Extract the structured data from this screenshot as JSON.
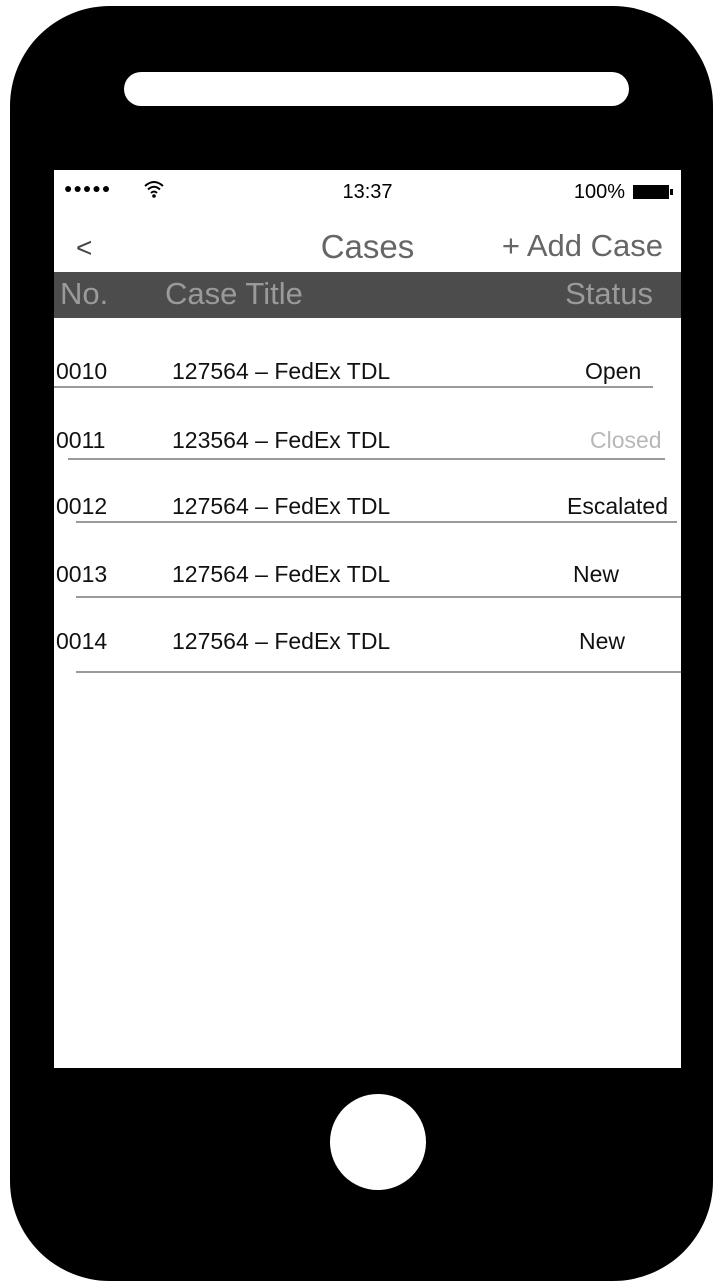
{
  "status_bar": {
    "signal": "●●●●●",
    "time": "13:37",
    "battery": "100%"
  },
  "nav": {
    "back_label": "<",
    "title": "Cases",
    "add_label": "+ Add Case"
  },
  "table": {
    "headers": {
      "no": "No.",
      "title": "Case Title",
      "status": "Status"
    },
    "rows": [
      {
        "no": "0010",
        "title": "127564 – FedEx TDL",
        "status": "Open"
      },
      {
        "no": "0011",
        "title": "123564 – FedEx TDL",
        "status": "Closed"
      },
      {
        "no": "0012",
        "title": "127564 – FedEx TDL",
        "status": "Escalated"
      },
      {
        "no": "0013",
        "title": "127564 – FedEx TDL",
        "status": "New"
      },
      {
        "no": "0014",
        "title": "127564 – FedEx TDL",
        "status": "New"
      }
    ]
  },
  "colors": {
    "phone_body": "#000000",
    "header_bar": "#4c4c4c",
    "closed_status": "#b8b8b8"
  }
}
